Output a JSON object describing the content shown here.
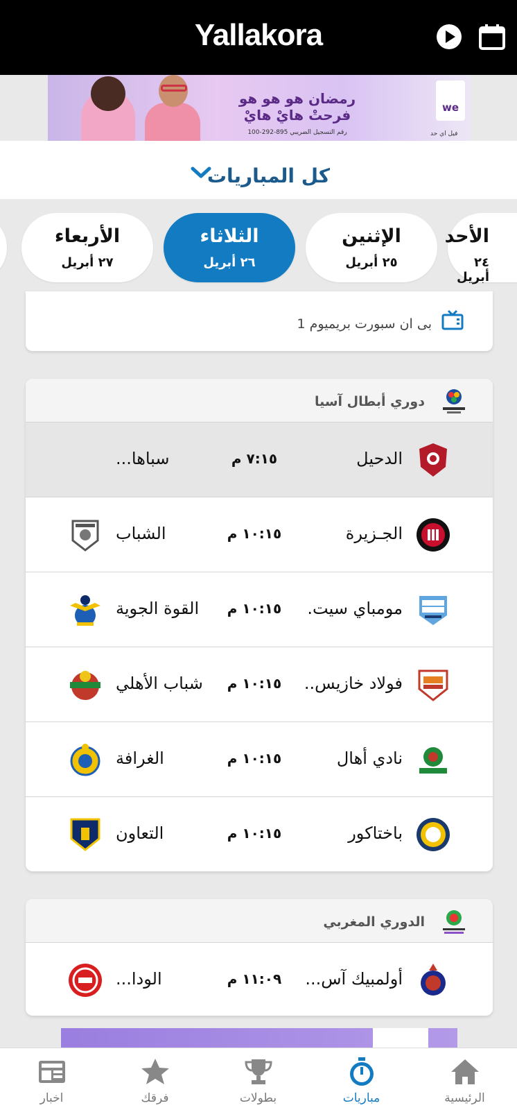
{
  "header": {
    "logo": "Yallakora",
    "icons": [
      "play-icon",
      "calendar-icon"
    ]
  },
  "ad": {
    "title_line1": "رمضان هو هو هو",
    "title_line2": "فرحتْ هايْ هايْ",
    "sub": "رقم التسجيل الضريبي 895-292-100",
    "brand": "we",
    "brand_caption": "فيل اي حد"
  },
  "section": {
    "title": "كل المباريات"
  },
  "days": [
    {
      "name": "الأربعاء",
      "date": "٢٧ أبريل",
      "active": false
    },
    {
      "name": "الثلاثاء",
      "date": "٢٦ أبريل",
      "active": true
    },
    {
      "name": "الإثنين",
      "date": "٢٥ أبريل",
      "active": false
    },
    {
      "name": "الأحد",
      "date": "٢٤ أبريل",
      "active": false
    }
  ],
  "tv_card": {
    "channel": "بى ان سبورت بريميوم 1"
  },
  "leagues": [
    {
      "name": "دوري أبطال آسيا",
      "logo": "champions-league-asia-logo",
      "matches": [
        {
          "home": "الدحيل",
          "time": "٧:١٥ م",
          "away": "سباها...",
          "highlight": true
        },
        {
          "home": "الجـزيرة",
          "time": "١٠:١٥ م",
          "away": "الشباب",
          "highlight": false
        },
        {
          "home": "مومباي سيت.",
          "time": "١٠:١٥ م",
          "away": "القوة الجوية",
          "highlight": false
        },
        {
          "home": "فولاد خازيس..",
          "time": "١٠:١٥ م",
          "away": "شباب الأهلي",
          "highlight": false
        },
        {
          "home": "نادي أهال",
          "time": "١٠:١٥ م",
          "away": "الغرافة",
          "highlight": false
        },
        {
          "home": "باختاكور",
          "time": "١٠:١٥ م",
          "away": "التعاون",
          "highlight": false
        }
      ]
    },
    {
      "name": "الدوري المغربي",
      "logo": "botola-pro-logo",
      "matches": [
        {
          "home": "أولمبيك آس...",
          "time": "١١:٠٩ م",
          "away": "الودا...",
          "highlight": false
        }
      ]
    }
  ],
  "bottom_nav": [
    {
      "label": "اخبار",
      "icon": "news-icon",
      "active": false
    },
    {
      "label": "فرقك",
      "icon": "star-icon",
      "active": false
    },
    {
      "label": "بطولات",
      "icon": "trophy-icon",
      "active": false
    },
    {
      "label": "مباريات",
      "icon": "stopwatch-icon",
      "active": true
    },
    {
      "label": "الرئيسية",
      "icon": "home-icon",
      "active": false
    }
  ],
  "colors": {
    "accent": "#137bc2",
    "title_blue": "#1a5a8c",
    "header_bg": "#000000"
  }
}
